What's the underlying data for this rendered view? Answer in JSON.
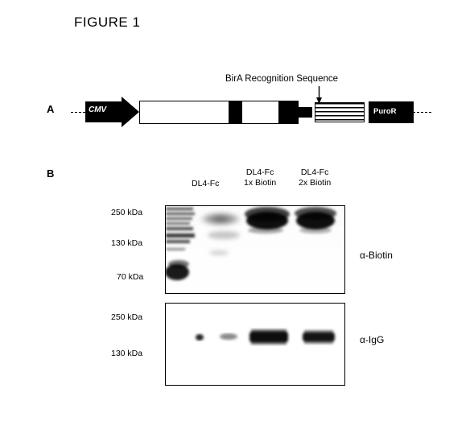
{
  "figure": {
    "title": "FIGURE 1"
  },
  "panels": {
    "a": {
      "label": "A",
      "annotation": "BirA Recognition Sequence",
      "elements": {
        "promoter": "CMV",
        "selection_marker": "PuroR"
      }
    },
    "b": {
      "label": "B",
      "lanes": [
        {
          "line1": "DL4-Fc",
          "line2": ""
        },
        {
          "line1": "DL4-Fc",
          "line2": "1x Biotin"
        },
        {
          "line1": "DL4-Fc",
          "line2": "2x Biotin"
        }
      ],
      "blots": [
        {
          "antibody": "α-Biotin",
          "markers": [
            "250 kDa",
            "130 kDa",
            "70 kDa"
          ]
        },
        {
          "antibody": "α-IgG",
          "markers": [
            "250 kDa",
            "130 kDa"
          ]
        }
      ]
    }
  }
}
